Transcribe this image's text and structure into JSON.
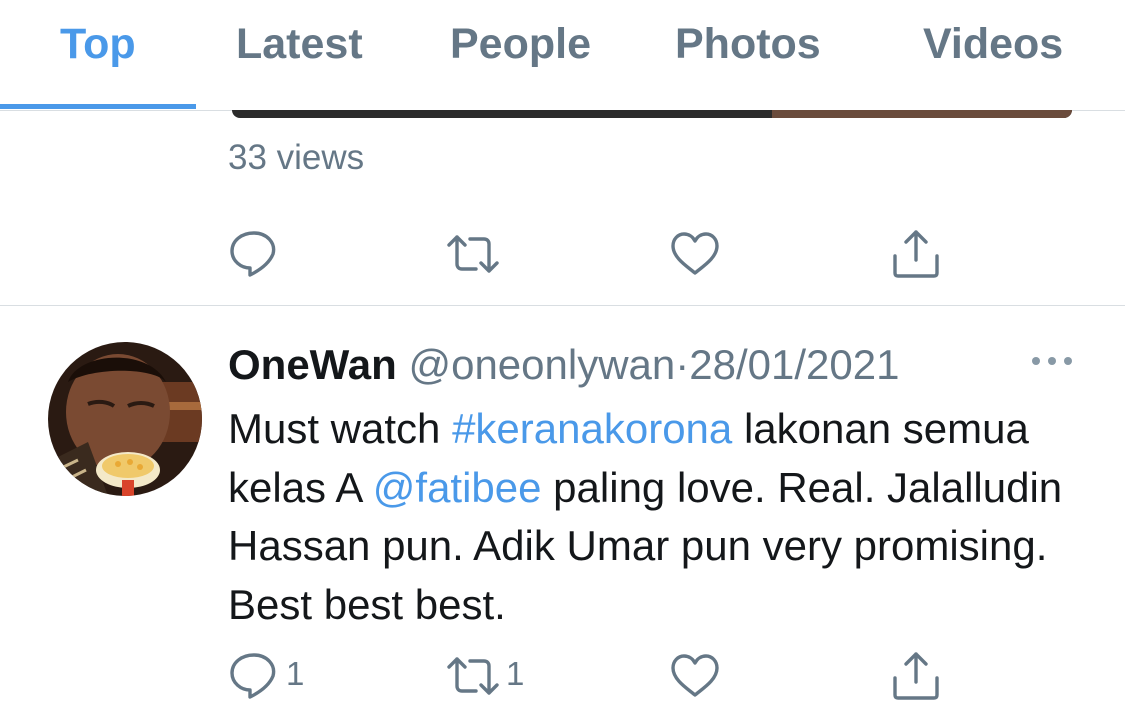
{
  "tabs": [
    {
      "label": "Top"
    },
    {
      "label": "Latest"
    },
    {
      "label": "People"
    },
    {
      "label": "Photos"
    },
    {
      "label": "Videos"
    }
  ],
  "active_tab": "Top",
  "previous_tweet": {
    "views_text": "33 views"
  },
  "tweet": {
    "display_name": "OneWan",
    "handle": "@oneonlywan",
    "separator": "·",
    "date": "28/01/2021",
    "text_parts": {
      "p1": "Must watch ",
      "hashtag": "#keranakorona",
      "p2": " lakonan semua kelas A ",
      "mention": "@fatibee",
      "p3": " paling love. Real. Jalalludin Hassan pun. Adik Umar pun very promising. Best best best."
    },
    "reply_count": "1",
    "retweet_count": "1"
  },
  "icons": {
    "reply": "reply-icon",
    "retweet": "retweet-icon",
    "like": "heart-icon",
    "share": "share-icon",
    "more": "more-options-icon"
  },
  "colors": {
    "accent": "#4a99e9",
    "muted": "#657786",
    "text": "#14171a",
    "divider": "#d9dee2"
  }
}
